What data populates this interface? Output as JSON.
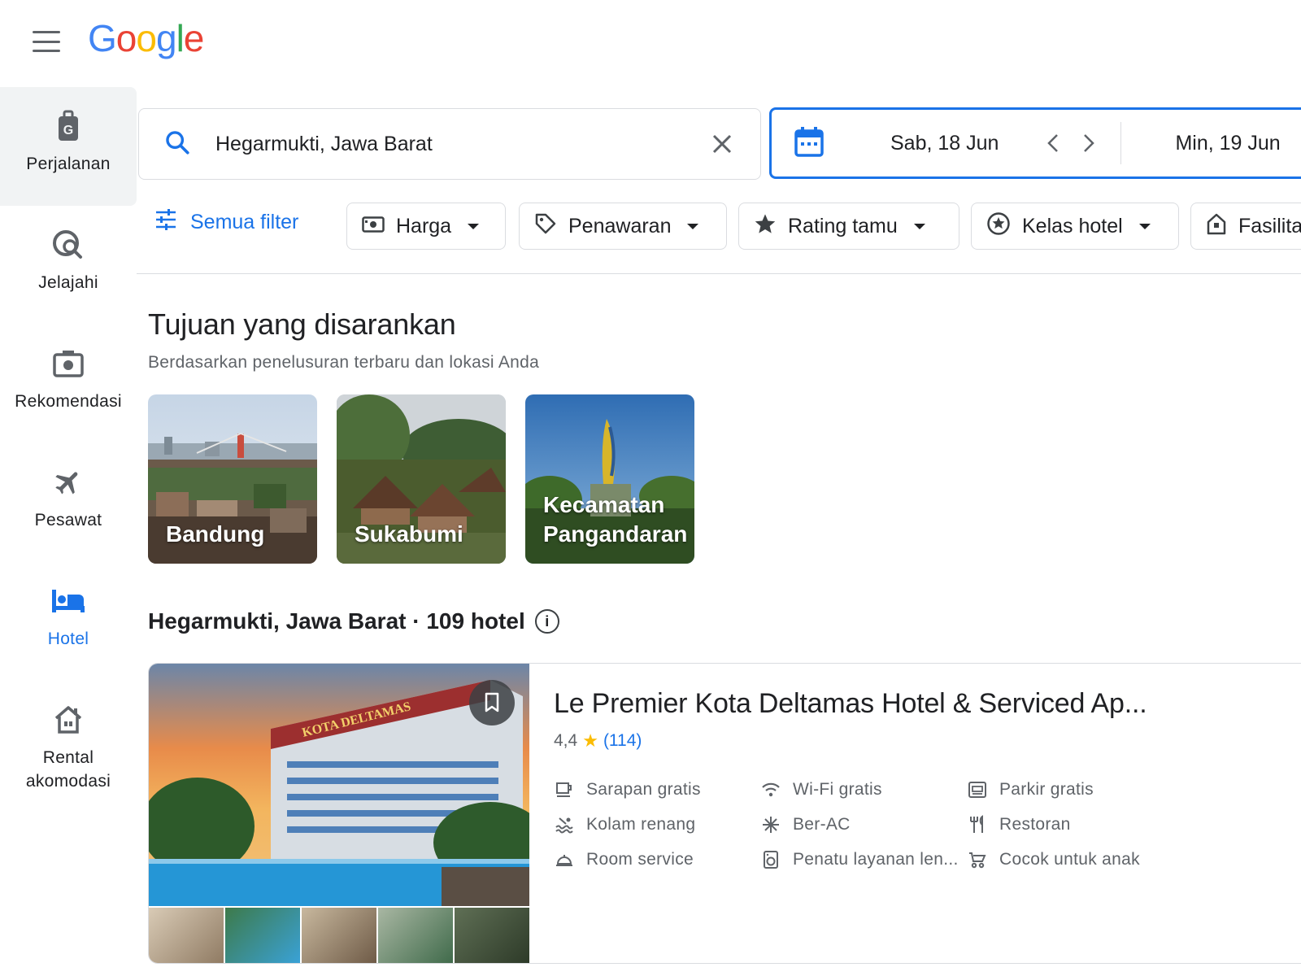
{
  "header": {
    "logo_letters": [
      {
        "ch": "G",
        "color": "#4285F4"
      },
      {
        "ch": "o",
        "color": "#EA4335"
      },
      {
        "ch": "o",
        "color": "#FBBC05"
      },
      {
        "ch": "g",
        "color": "#4285F4"
      },
      {
        "ch": "l",
        "color": "#34A853"
      },
      {
        "ch": "e",
        "color": "#EA4335"
      }
    ]
  },
  "sidebar": {
    "items": [
      {
        "label": "Perjalanan",
        "icon": "luggage-icon"
      },
      {
        "label": "Jelajahi",
        "icon": "explore-icon"
      },
      {
        "label": "Rekomendasi",
        "icon": "camera-icon"
      },
      {
        "label": "Pesawat",
        "icon": "airplane-icon"
      },
      {
        "label": "Hotel",
        "icon": "bed-icon"
      },
      {
        "label": "Rental akomodasi",
        "icon": "house-icon"
      }
    ]
  },
  "search": {
    "value": "Hegarmukti, Jawa Barat"
  },
  "dates": {
    "checkin": "Sab, 18 Jun",
    "checkout": "Min, 19 Jun"
  },
  "filters": {
    "all_label": "Semua filter",
    "chips": [
      "Harga",
      "Penawaran",
      "Rating tamu",
      "Kelas hotel",
      "Fasilita"
    ]
  },
  "suggestions": {
    "title": "Tujuan yang disarankan",
    "subtitle": "Berdasarkan penelusuran terbaru dan lokasi Anda",
    "items": [
      "Bandung",
      "Sukabumi",
      "Kecamatan Pangandaran"
    ]
  },
  "results": {
    "title": "Hegarmukti, Jawa Barat · 109 hotel"
  },
  "hotel": {
    "name": "Le Premier Kota Deltamas Hotel & Serviced Ap...",
    "rating": "4,4",
    "reviews": "(114)",
    "amenities": [
      "Sarapan gratis",
      "Wi-Fi gratis",
      "Parkir gratis",
      "Kolam renang",
      "Ber-AC",
      "Restoran",
      "Room service",
      "Penatu layanan len...",
      "Cocok untuk anak"
    ],
    "sign_text": "KOTA DELTAMAS"
  },
  "colors": {
    "accent": "#1a73e8",
    "star": "#fbbc04"
  }
}
